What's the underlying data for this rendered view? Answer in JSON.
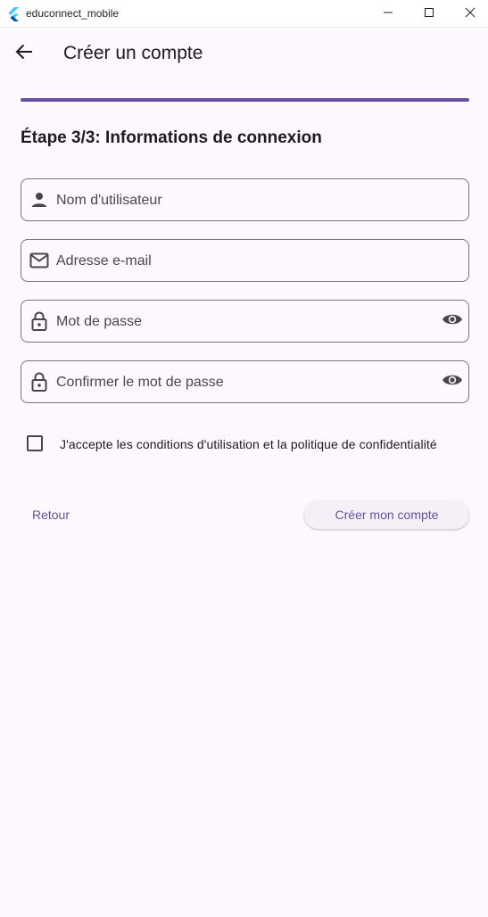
{
  "window": {
    "title": "educonnect_mobile",
    "controls": [
      "minimize-icon",
      "maximize-icon",
      "close-icon"
    ]
  },
  "appbar": {
    "back_icon": "arrow-back-icon",
    "title": "Créer un compte"
  },
  "progress": {
    "value": 1.0
  },
  "step": {
    "title": "Étape 3/3: Informations de connexion"
  },
  "fields": [
    {
      "icon": "person-icon",
      "placeholder": "Nom d'utilisateur"
    },
    {
      "icon": "mail-icon",
      "placeholder": "Adresse e-mail"
    },
    {
      "icon": "lock-icon",
      "placeholder": "Mot de passe",
      "trailing_icon": "eye-icon"
    },
    {
      "icon": "lock-icon",
      "placeholder": "Confirmer le mot de passe",
      "trailing_icon": "eye-icon"
    }
  ],
  "terms": {
    "checked": false,
    "label": "J'accepte les conditions d'utilisation et la politique de confidentialité"
  },
  "actions": {
    "back_label": "Retour",
    "create_label": "Créer mon compte"
  },
  "colors": {
    "primary": "#6750a4",
    "background": "#fdf7fe",
    "outline": "#79747e"
  }
}
